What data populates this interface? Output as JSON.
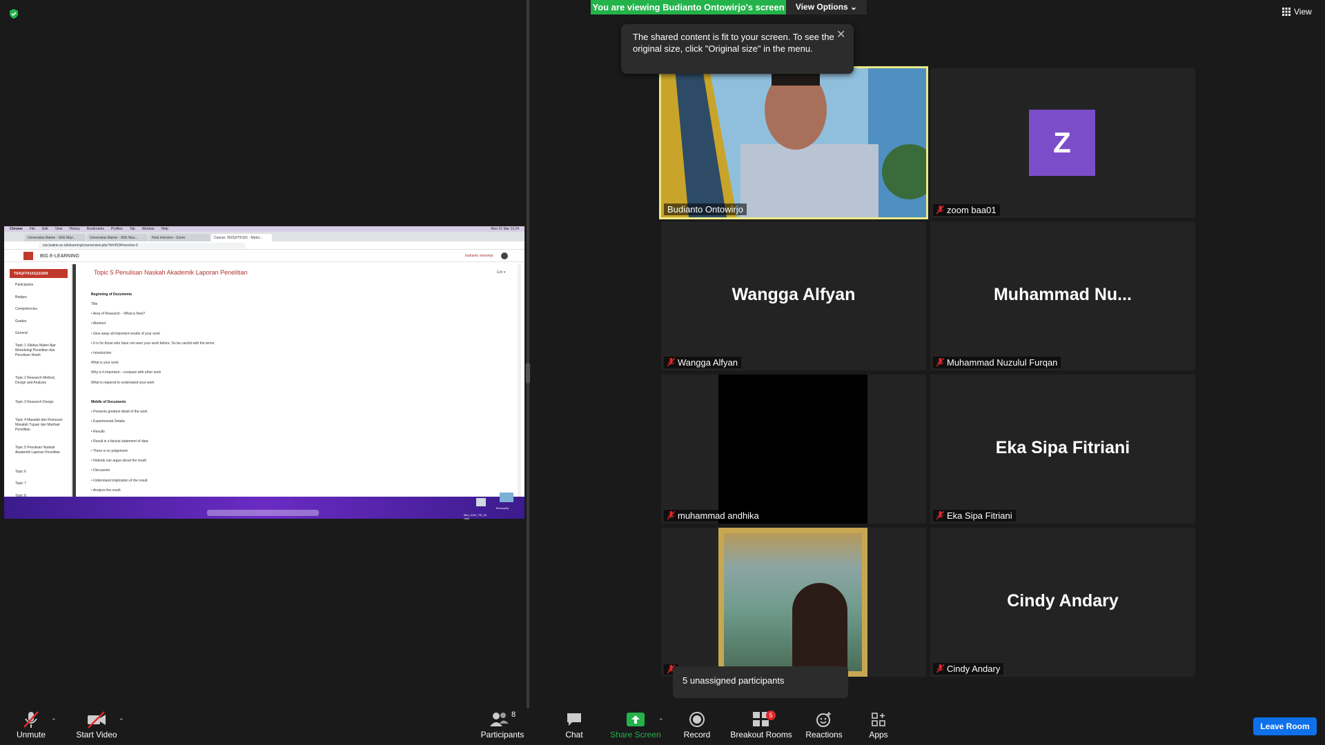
{
  "banner": {
    "viewing_text": "You are viewing Budianto Ontowirjo's screen",
    "view_options": "View Options ⌄",
    "view_label": "View"
  },
  "tooltip": {
    "text": "The shared content is fit to your screen. To see the original size, click \"Original size\" in the menu."
  },
  "shared_screen": {
    "mac_menu": [
      "Chrome",
      "File",
      "Edit",
      "View",
      "History",
      "Bookmarks",
      "Profiles",
      "Tab",
      "Window",
      "Help"
    ],
    "clock": "Mon 21 Mar 13.34",
    "tabs": [
      "Universitas Bakrie - SKE Maz...",
      "Universitas Bakrie - SKE Maz...",
      "Host Intorslon - Zoom",
      "Course: 2021|FTK101 - Metro..."
    ],
    "url": "sso.bakrie.ac.id/elearning/course/view.php?id=3534#section-5",
    "site_title": "BIG E-LEARNING",
    "user": "budianto ontowirjo",
    "course_badge": "TS41|FTK101|121609",
    "sidebar": [
      "Participants",
      "Badges",
      "Competencies",
      "Grades",
      "General",
      "Topic 1 Silabus Materi Ajar Metodologi Penelitian dan Penulisan Ilmiah",
      "Topic 2 Research Method, Design and Analysis",
      "Topic 3 Research Design",
      "Topic 4 Masalah dan Rumusan Masalah Tujuan dan Manfaat Penelitian",
      "Topic 5 Penulisan Naskah Akademik Laporan Penelitian",
      "Topic 6",
      "Topic 7",
      "Topic 8"
    ],
    "content_title": "Topic 5 Penulisan Naskah Akademik Laporan Penelitian",
    "edit_label": "Edit ▾",
    "lines": [
      {
        "text": "Beginning of Documents",
        "bold": true
      },
      {
        "text": "Title",
        "bold": false
      },
      {
        "text": "• Area of Research – What is New?",
        "bold": false
      },
      {
        "text": "• Abstract",
        "bold": false
      },
      {
        "text": "• Give away all important results of your work",
        "bold": false
      },
      {
        "text": "• It is for those who have not seen your work before. So be careful with the terms",
        "bold": false
      },
      {
        "text": "• Introduction",
        "bold": false
      },
      {
        "text": "What is your work",
        "bold": false
      },
      {
        "text": "Why is it important – compare with other work",
        "bold": false
      },
      {
        "text": "What is required to understand your work",
        "bold": false
      },
      {
        "text": "Middle of Documents",
        "bold": true
      },
      {
        "text": "• Presents greatest detail of the work",
        "bold": false
      },
      {
        "text": "• Experimental Details",
        "bold": false
      },
      {
        "text": "• Results",
        "bold": false
      },
      {
        "text": "• Result is a factual statement of data",
        "bold": false
      },
      {
        "text": "• There is no judgement",
        "bold": false
      },
      {
        "text": "• Nobody can argue about the result",
        "bold": false
      },
      {
        "text": "• Discussion",
        "bold": false
      },
      {
        "text": "• Understand implication of the result",
        "bold": false
      },
      {
        "text": "• Analyze the result",
        "bold": false
      }
    ],
    "desktop_labels": [
      "Mks_UAS_TSI_00 .xlsx",
      "Temesprity"
    ]
  },
  "tiles": {
    "budianto": {
      "name": "Budianto Ontowirjo"
    },
    "zoom": {
      "initial": "Z",
      "name": "zoom baa01"
    },
    "wangga": {
      "display": "Wangga Alfyan",
      "name": "Wangga Alfyan"
    },
    "muhammad": {
      "display": "Muhammad  Nu...",
      "name": "Muhammad Nuzulul Furqan"
    },
    "andhika": {
      "name": "muhammad andhika"
    },
    "eka": {
      "display": "Eka Sipa Fitriani",
      "name": "Eka Sipa Fitriani"
    },
    "cindy": {
      "display": "Cindy Andary",
      "name": "Cindy Andary"
    }
  },
  "unassigned": "5 unassigned participants",
  "toolbar": {
    "unmute": "Unmute",
    "start_video": "Start Video",
    "participants": "Participants",
    "participants_count": "8",
    "chat": "Chat",
    "share_screen": "Share Screen",
    "record": "Record",
    "breakout_rooms": "Breakout Rooms",
    "breakout_badge": "5",
    "reactions": "Reactions",
    "apps": "Apps",
    "leave": "Leave Room"
  },
  "colors": {
    "share_green": "#23b34a",
    "active_speaker": "#ecea86",
    "leave_blue": "#0e71eb",
    "avatar_purple": "#7c4dc9"
  }
}
